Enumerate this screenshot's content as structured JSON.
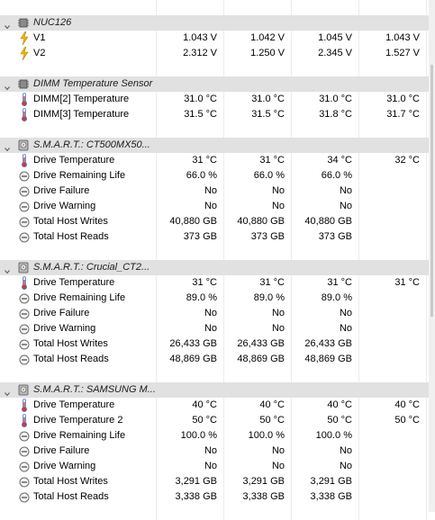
{
  "groups": [
    {
      "title": "NUC126",
      "icon": "chip-icon",
      "rows": [
        {
          "icon": "voltage-icon",
          "label": "V1",
          "values": [
            "1.043 V",
            "1.042 V",
            "1.045 V",
            "1.043 V"
          ]
        },
        {
          "icon": "voltage-icon",
          "label": "V2",
          "values": [
            "2.312 V",
            "1.250 V",
            "2.345 V",
            "1.527 V"
          ]
        }
      ]
    },
    {
      "title": "DIMM Temperature Sensor",
      "icon": "chip-icon",
      "rows": [
        {
          "icon": "thermometer-icon",
          "label": "DIMM[2] Temperature",
          "values": [
            "31.0 °C",
            "31.0 °C",
            "31.0 °C",
            "31.0 °C"
          ]
        },
        {
          "icon": "thermometer-icon",
          "label": "DIMM[3] Temperature",
          "values": [
            "31.5 °C",
            "31.5 °C",
            "31.8 °C",
            "31.7 °C"
          ]
        }
      ]
    },
    {
      "title": "S.M.A.R.T.: CT500MX50...",
      "icon": "drive-icon",
      "rows": [
        {
          "icon": "thermometer-icon",
          "label": "Drive Temperature",
          "values": [
            "31 °C",
            "31 °C",
            "34 °C",
            "32 °C"
          ]
        },
        {
          "icon": "gauge-icon",
          "label": "Drive Remaining Life",
          "values": [
            "66.0 %",
            "66.0 %",
            "66.0 %",
            ""
          ]
        },
        {
          "icon": "gauge-icon",
          "label": "Drive Failure",
          "values": [
            "No",
            "No",
            "No",
            ""
          ]
        },
        {
          "icon": "gauge-icon",
          "label": "Drive Warning",
          "values": [
            "No",
            "No",
            "No",
            ""
          ]
        },
        {
          "icon": "gauge-icon",
          "label": "Total Host Writes",
          "values": [
            "40,880 GB",
            "40,880 GB",
            "40,880 GB",
            ""
          ]
        },
        {
          "icon": "gauge-icon",
          "label": "Total Host Reads",
          "values": [
            "373 GB",
            "373 GB",
            "373 GB",
            ""
          ]
        }
      ]
    },
    {
      "title": "S.M.A.R.T.: Crucial_CT2...",
      "icon": "drive-icon",
      "rows": [
        {
          "icon": "thermometer-icon",
          "label": "Drive Temperature",
          "values": [
            "31 °C",
            "31 °C",
            "31 °C",
            "31 °C"
          ]
        },
        {
          "icon": "gauge-icon",
          "label": "Drive Remaining Life",
          "values": [
            "89.0 %",
            "89.0 %",
            "89.0 %",
            ""
          ]
        },
        {
          "icon": "gauge-icon",
          "label": "Drive Failure",
          "values": [
            "No",
            "No",
            "No",
            ""
          ]
        },
        {
          "icon": "gauge-icon",
          "label": "Drive Warning",
          "values": [
            "No",
            "No",
            "No",
            ""
          ]
        },
        {
          "icon": "gauge-icon",
          "label": "Total Host Writes",
          "values": [
            "26,433 GB",
            "26,433 GB",
            "26,433 GB",
            ""
          ]
        },
        {
          "icon": "gauge-icon",
          "label": "Total Host Reads",
          "values": [
            "48,869 GB",
            "48,869 GB",
            "48,869 GB",
            ""
          ]
        }
      ]
    },
    {
      "title": "S.M.A.R.T.: SAMSUNG M...",
      "icon": "drive-icon",
      "rows": [
        {
          "icon": "thermometer-icon",
          "label": "Drive Temperature",
          "values": [
            "40 °C",
            "40 °C",
            "40 °C",
            "40 °C"
          ]
        },
        {
          "icon": "thermometer-icon",
          "label": "Drive Temperature 2",
          "values": [
            "50 °C",
            "50 °C",
            "50 °C",
            "50 °C"
          ]
        },
        {
          "icon": "gauge-icon",
          "label": "Drive Remaining Life",
          "values": [
            "100.0 %",
            "100.0 %",
            "100.0 %",
            ""
          ]
        },
        {
          "icon": "gauge-icon",
          "label": "Drive Failure",
          "values": [
            "No",
            "No",
            "No",
            ""
          ]
        },
        {
          "icon": "gauge-icon",
          "label": "Drive Warning",
          "values": [
            "No",
            "No",
            "No",
            ""
          ]
        },
        {
          "icon": "gauge-icon",
          "label": "Total Host Writes",
          "values": [
            "3,291 GB",
            "3,291 GB",
            "3,291 GB",
            ""
          ]
        },
        {
          "icon": "gauge-icon",
          "label": "Total Host Reads",
          "values": [
            "3,338 GB",
            "3,338 GB",
            "3,338 GB",
            ""
          ]
        }
      ]
    }
  ],
  "colors": {
    "header_bg": "#e1e1e1",
    "voltage_icon": "#f2b400",
    "thermometer_icon": "#5a78c8",
    "grid_line": "#ececec"
  }
}
